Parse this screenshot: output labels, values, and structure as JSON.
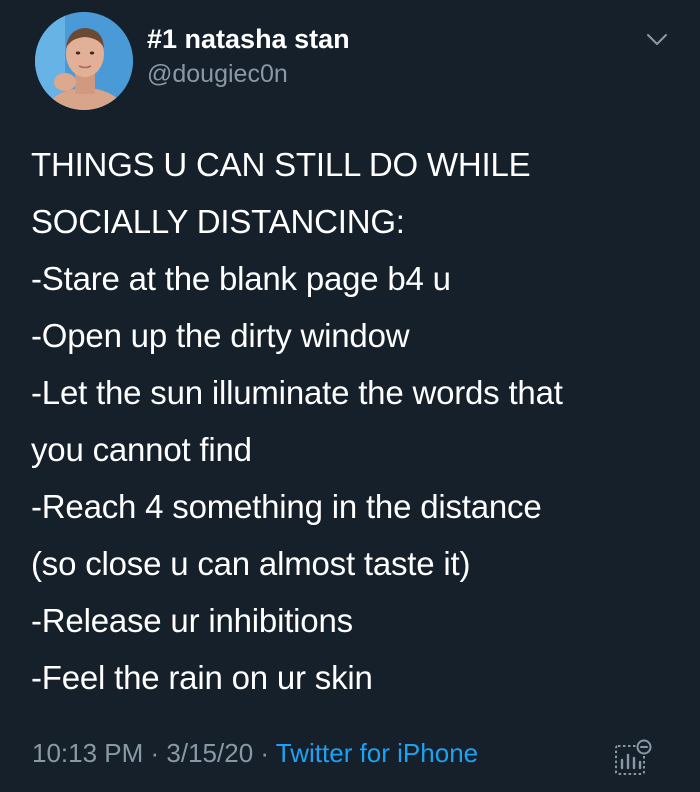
{
  "user": {
    "display_name": "#1 natasha stan",
    "handle": "@dougiec0n"
  },
  "tweet": {
    "heading_lines": [
      "THINGS U CAN STILL DO WHILE",
      "SOCIALLY DISTANCING:"
    ],
    "body_lines": [
      "-Stare at the blank page b4 u",
      "-Open up the dirty window",
      "-Let the sun illuminate the words that",
      "you cannot find",
      "-Reach 4 something in the distance",
      "(so close u can almost taste it)",
      "-Release ur inhibitions",
      "-Feel the rain on ur skin"
    ]
  },
  "meta": {
    "time": "10:13 PM",
    "separator1": " · ",
    "date": "3/15/20",
    "separator2": " · ",
    "source": "Twitter for iPhone"
  },
  "icons": {
    "chevron": "chevron-down-icon",
    "analytics": "analytics-icon"
  },
  "colors": {
    "background": "#15202b",
    "text": "#ffffff",
    "secondary": "#8899a6",
    "link": "#1da1f2"
  }
}
